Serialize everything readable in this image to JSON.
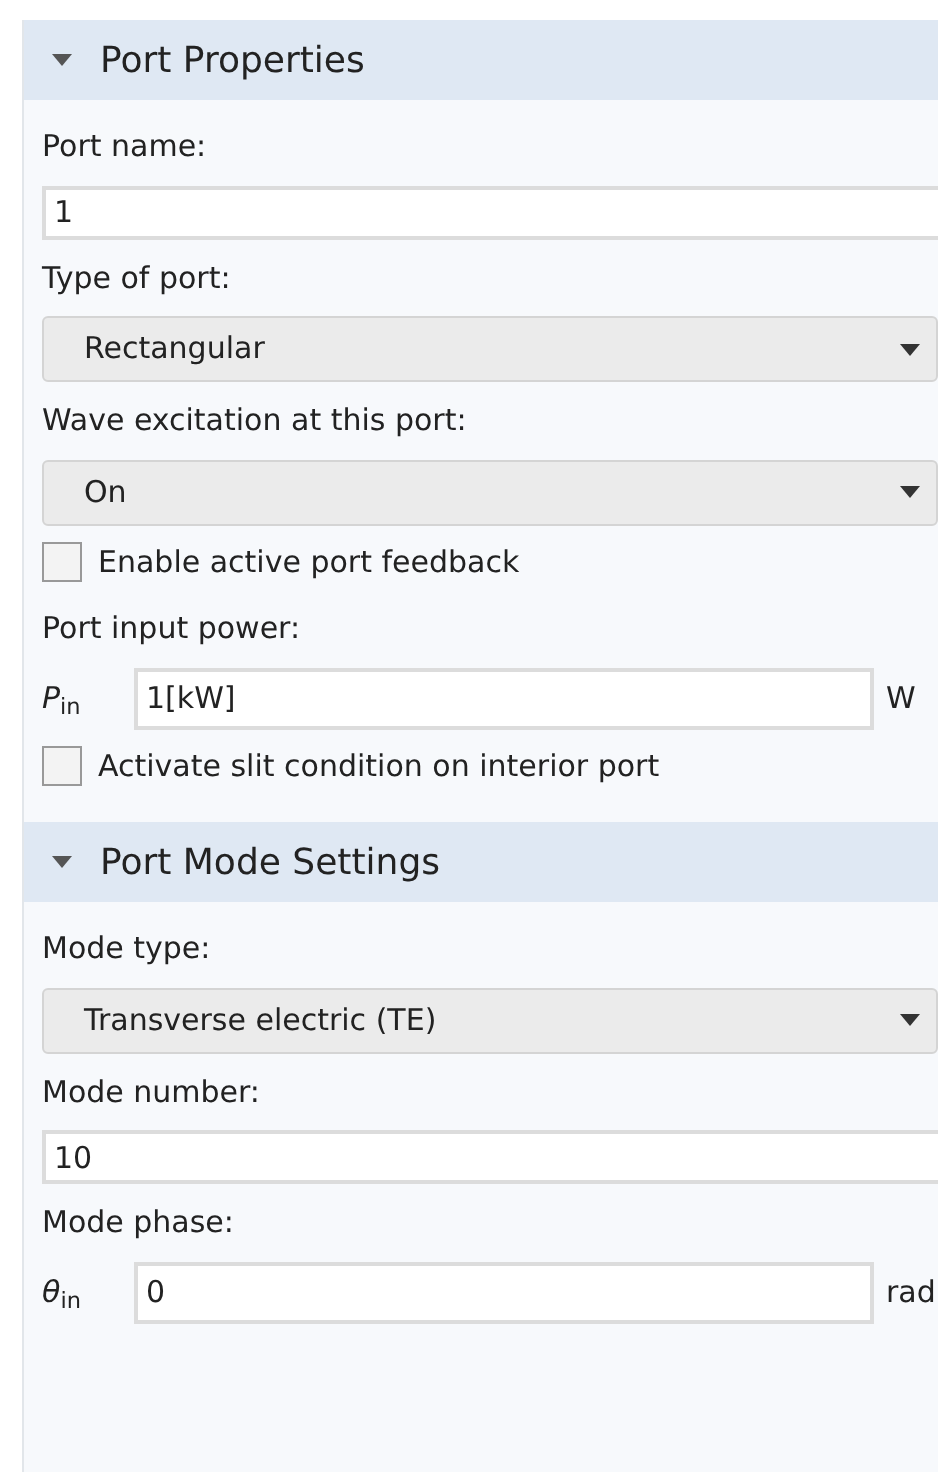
{
  "sections": [
    {
      "title": "Port Properties",
      "expanded": true,
      "items": [
        {
          "kind": "label",
          "text": "Port name:"
        },
        {
          "kind": "text_field",
          "value": "1"
        },
        {
          "kind": "label",
          "text": "Type of port:"
        },
        {
          "kind": "select",
          "value": "Rectangular"
        },
        {
          "kind": "label",
          "text": "Wave excitation at this port:"
        },
        {
          "kind": "select",
          "value": "On"
        },
        {
          "kind": "checkbox",
          "text": "Enable active port feedback",
          "checked": false
        },
        {
          "kind": "label",
          "text": "Port input power:"
        },
        {
          "kind": "quantity_field",
          "symbol": "*P*$_{in}$",
          "value": "1[kW]",
          "unit": "W"
        },
        {
          "kind": "checkbox",
          "text": "Activate slit condition on interior port",
          "checked": false
        }
      ]
    },
    {
      "title": "Port Mode Settings",
      "expanded": true,
      "items": [
        {
          "kind": "label",
          "text": "Mode type:"
        },
        {
          "kind": "select",
          "value": "Transverse electric (TE)"
        },
        {
          "kind": "label",
          "text": "Mode number:"
        },
        {
          "kind": "text_field",
          "value": "10"
        },
        {
          "kind": "label",
          "text": "Mode phase:"
        },
        {
          "kind": "quantity_field",
          "symbol": "*θ*$_{in}$",
          "value": "0",
          "unit": "rad"
        }
      ]
    }
  ]
}
